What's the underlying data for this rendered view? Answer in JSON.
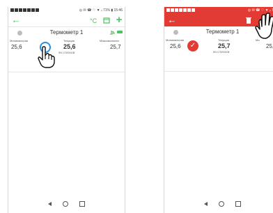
{
  "screens": [
    {
      "id": "left",
      "status_right": "◎ ✉ ☎ ♡ ▼ ᵢₗ 71% ▮ 15:46",
      "toolbar": {
        "icons": [
          "back-arrow-icon",
          "temperature-edit-icon",
          "calendar-icon",
          "add-icon"
        ]
      },
      "device": {
        "name": "Термометр 1",
        "min_label": "Минимальная",
        "min_value": "25,6",
        "cur_label": "Текущая",
        "cur_value": "25,6",
        "max_label": "Максимальная",
        "max_value": "25,7",
        "serial": "SN 170200108"
      }
    },
    {
      "id": "right",
      "status_right": "◎ ✉ ☎ ♡ ▼ ᵢₗ 71%",
      "toolbar": {
        "icons": [
          "back-arrow-icon",
          "trash-icon"
        ]
      },
      "device": {
        "name": "Термометр 1",
        "min_label": "Минимальная",
        "min_value": "25,6",
        "cur_label": "Текущая",
        "cur_value": "25,7",
        "max_label": "Ма",
        "max_value": "25,",
        "serial": "SN 170200108"
      }
    }
  ],
  "colors": {
    "accent_green": "#49c262",
    "selection_red": "#e23b33",
    "tap_blue": "#2b8fe0"
  }
}
